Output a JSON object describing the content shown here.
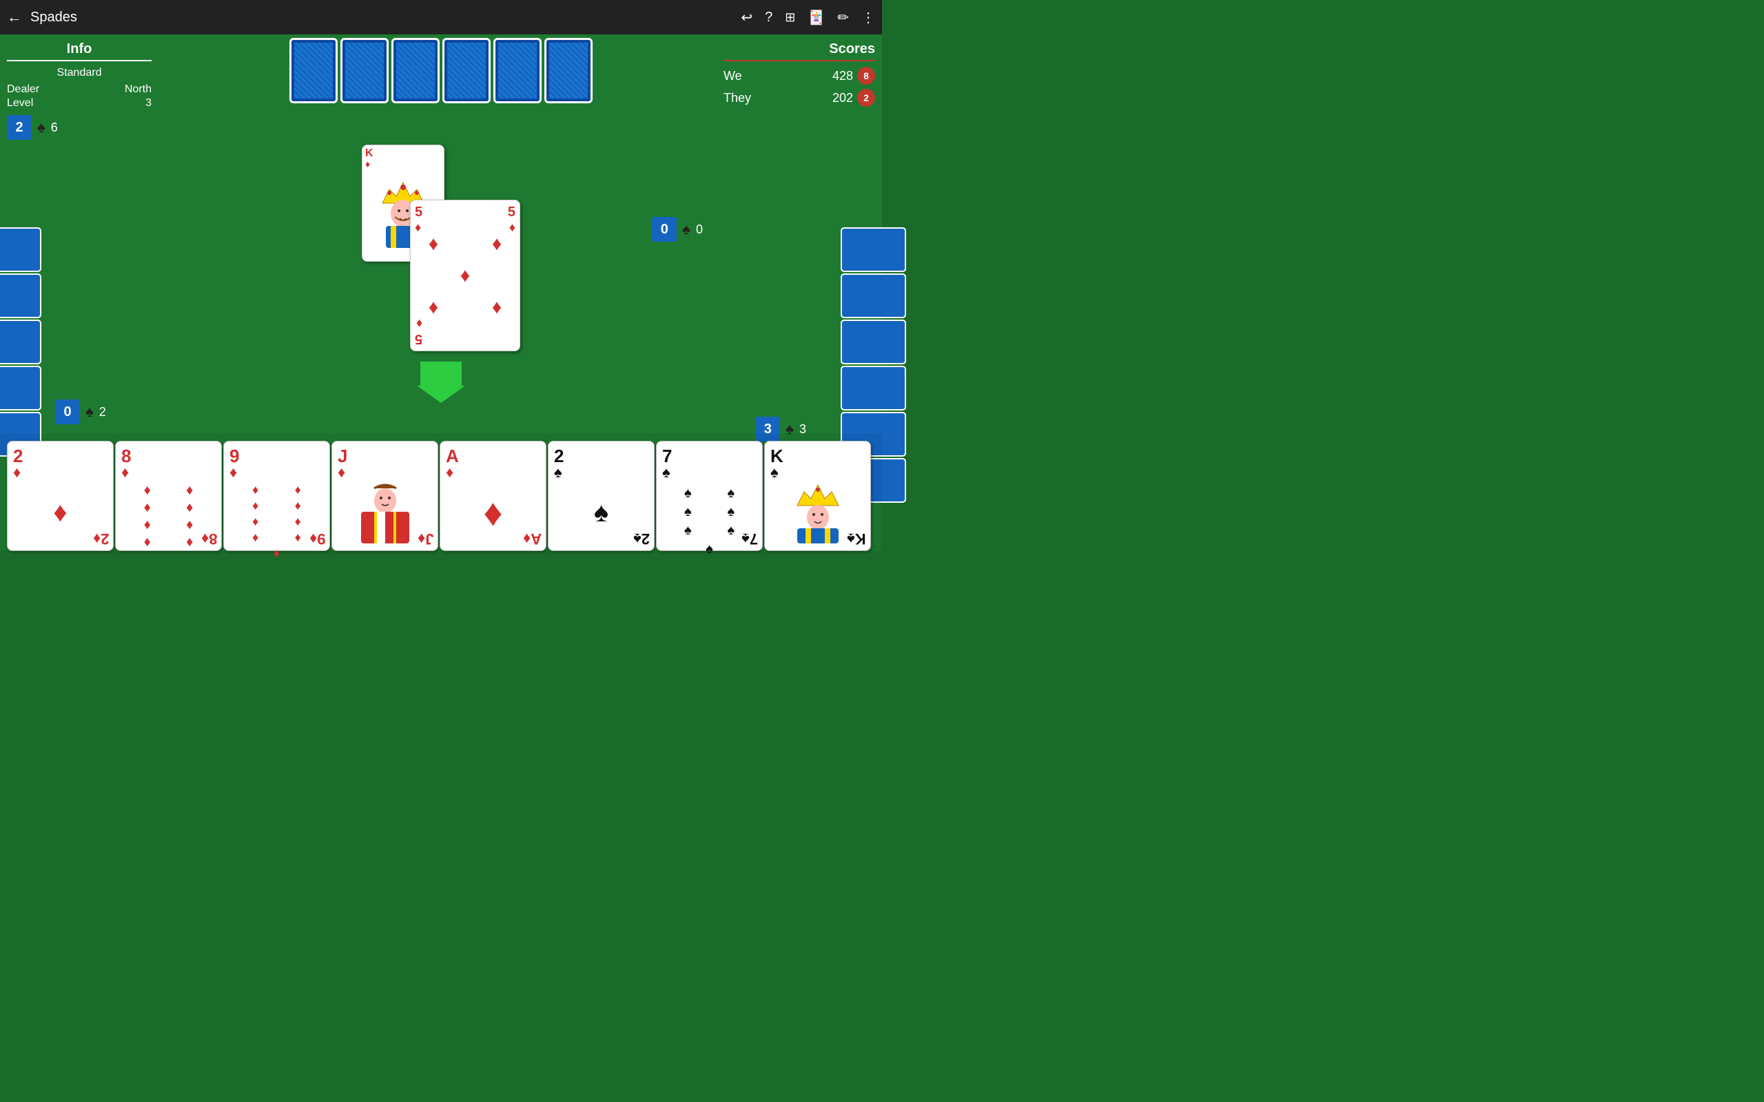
{
  "topbar": {
    "title": "Spades",
    "back_icon": "←",
    "help_icon": "?",
    "gift_icon": "⊕",
    "save_icon": "🃏",
    "edit_icon": "✎",
    "more_icon": "⋮"
  },
  "info": {
    "title": "Info",
    "variant": "Standard",
    "dealer_label": "Dealer",
    "dealer_value": "North",
    "level_label": "Level",
    "level_value": "3",
    "south_bid": "2",
    "south_tricks": "6"
  },
  "scores": {
    "title": "Scores",
    "we_label": "We",
    "we_score": "428",
    "we_bags": "8",
    "they_label": "They",
    "they_score": "202",
    "they_bags": "2"
  },
  "bids": {
    "north": {
      "bid": "0",
      "tricks": "0"
    },
    "west": {
      "bid": "0",
      "tricks": "2"
    },
    "east": {
      "bid": "3",
      "tricks": "3"
    },
    "south": {
      "bid": "2",
      "spade": "♠"
    }
  },
  "center_cards": {
    "king": {
      "rank": "K",
      "suit": "♦",
      "color": "red"
    },
    "five": {
      "rank": "5",
      "suit": "♦",
      "color": "red"
    }
  },
  "hand_cards": [
    {
      "rank": "2",
      "suit": "♦",
      "color": "red"
    },
    {
      "rank": "8",
      "suit": "♦",
      "color": "red"
    },
    {
      "rank": "9",
      "suit": "♦",
      "color": "red"
    },
    {
      "rank": "J",
      "suit": "♦",
      "color": "red"
    },
    {
      "rank": "A",
      "suit": "♦",
      "color": "red"
    },
    {
      "rank": "2",
      "suit": "♠",
      "color": "black"
    },
    {
      "rank": "7",
      "suit": "♠",
      "color": "black"
    },
    {
      "rank": "K",
      "suit": "♠",
      "color": "black"
    }
  ],
  "colors": {
    "table_green": "#1e7a30",
    "bid_blue": "#1565c0",
    "badge_red": "#c0392b",
    "arrow_green": "#2ecc40"
  }
}
